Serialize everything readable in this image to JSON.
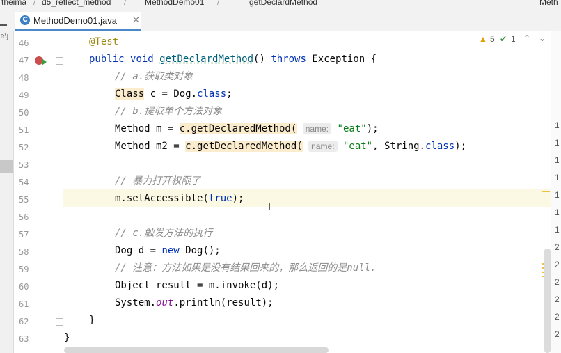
{
  "breadcrumb": {
    "items": [
      "theima",
      "d5_reflect_method",
      "MethodDemo01",
      "getDeclardMethod"
    ],
    "right_tab": "Meth"
  },
  "editor": {
    "tab": {
      "label": "MethodDemo01.java"
    },
    "left_partial_text": "le\\j",
    "indicators": {
      "warnings": "5",
      "weak_warnings": "1"
    },
    "line_numbers": [
      "46",
      "47",
      "48",
      "49",
      "50",
      "51",
      "52",
      "53",
      "54",
      "55",
      "56",
      "57",
      "58",
      "59",
      "60",
      "61",
      "62",
      "63"
    ],
    "lines": {
      "l46": {
        "anno": "@Test"
      },
      "l47": {
        "kw1": "public",
        "kw2": "void",
        "method": "getDeclardMethod",
        "paren": "() ",
        "throws": "throws",
        "rest": " Exception {"
      },
      "l48": {
        "comment": "// a.获取类对象"
      },
      "l49": {
        "type": "Class",
        "rest": " c = Dog.",
        "kw": "class",
        "end": ";"
      },
      "l50": {
        "comment": "// b.提取单个方法对象"
      },
      "l51": {
        "lhs": "Method m = ",
        "call": "c.getDeclaredMethod(",
        "hint": "name:",
        "str": "\"eat\"",
        "end": ");"
      },
      "l52": {
        "lhs": "Method m2 = ",
        "call": "c.getDeclaredMethod(",
        "hint": "name:",
        "str": "\"eat\"",
        "mid": ", String.",
        "kw": "class",
        "end": ");"
      },
      "l54": {
        "comment": "// 暴力打开权限了"
      },
      "l55": {
        "pre": "m.setAccessible(",
        "kw": "true",
        "end": ");"
      },
      "l57": {
        "comment": "// c.触发方法的执行"
      },
      "l58": {
        "pre": "Dog d = ",
        "kw": "new",
        "end": " Dog();"
      },
      "l59": {
        "comment": "// 注意：方法如果是没有结果回来的，那么返回的是null."
      },
      "l60": {
        "text": "Object result = m.invoke(d);"
      },
      "l61": {
        "pre": "System.",
        "field": "out",
        "end": ".println(result);"
      },
      "l62": {
        "text": "}"
      },
      "l63": {
        "text": "}"
      }
    },
    "right_gutter_numbers": [
      "1",
      "1",
      "1",
      "1",
      "1",
      "1",
      "1",
      "2",
      "2",
      "2",
      "2",
      "2",
      "2"
    ]
  },
  "colors": {
    "keyword": "#0033b3",
    "annotation": "#9e880d",
    "comment": "#8c8c8c",
    "string": "#067d17",
    "field": "#871094",
    "highlight": "#faeccc",
    "tab_accent": "#4a88c7"
  }
}
